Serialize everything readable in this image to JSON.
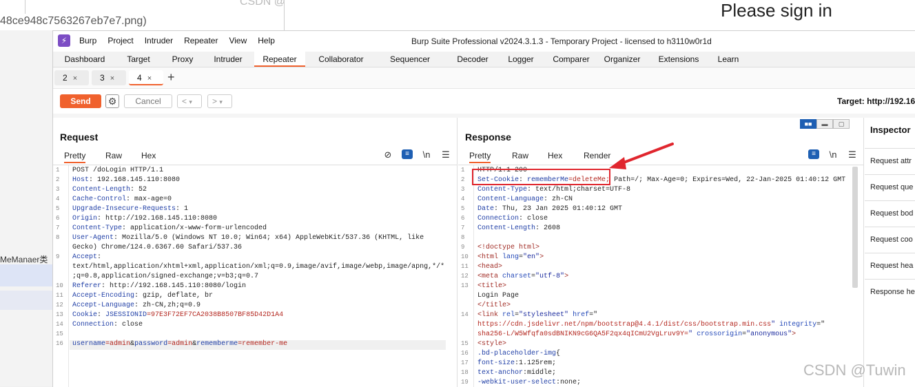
{
  "background": {
    "filename": "48ce948c7563267eb7e7.png)",
    "csdn_top": "CSDN @",
    "signin": "Please sign in",
    "manager_text": "MeManaer类"
  },
  "app": {
    "title": "Burp Suite Professional v2024.3.1.3 - Temporary Project - licensed to h3110w0r1d",
    "menu": [
      "Burp",
      "Project",
      "Intruder",
      "Repeater",
      "View",
      "Help"
    ]
  },
  "main_tabs": [
    "Dashboard",
    "Target",
    "Proxy",
    "Intruder",
    "Repeater",
    "Collaborator",
    "Sequencer",
    "Decoder",
    "Logger",
    "Comparer",
    "Organizer",
    "Extensions",
    "Learn"
  ],
  "main_tab_active": "Repeater",
  "repeater_tabs": [
    {
      "label": "2",
      "close": "×"
    },
    {
      "label": "3",
      "close": "×"
    },
    {
      "label": "4",
      "close": "×"
    }
  ],
  "repeater_tab_plus": "+",
  "toolbar": {
    "send": "Send",
    "cancel": "Cancel",
    "back": "<",
    "forward": ">",
    "dropdown": "▾",
    "target": "Target: http://192.16"
  },
  "request": {
    "title": "Request",
    "tabs": [
      "Pretty",
      "Raw",
      "Hex"
    ],
    "newline_icon": "\\n",
    "lines": [
      {
        "n": "1",
        "parts": [
          [
            "v",
            "POST /doLogin HTTP/1.1"
          ]
        ]
      },
      {
        "n": "2",
        "parts": [
          [
            "k",
            "Host"
          ],
          [
            "v",
            ": 192.168.145.110:8080"
          ]
        ]
      },
      {
        "n": "3",
        "parts": [
          [
            "k",
            "Content-Length"
          ],
          [
            "v",
            ": 52"
          ]
        ]
      },
      {
        "n": "4",
        "parts": [
          [
            "k",
            "Cache-Control"
          ],
          [
            "v",
            ": max-age=0"
          ]
        ]
      },
      {
        "n": "5",
        "parts": [
          [
            "k",
            "Upgrade-Insecure-Requests"
          ],
          [
            "v",
            ": 1"
          ]
        ]
      },
      {
        "n": "6",
        "parts": [
          [
            "k",
            "Origin"
          ],
          [
            "v",
            ": http://192.168.145.110:8080"
          ]
        ]
      },
      {
        "n": "7",
        "parts": [
          [
            "k",
            "Content-Type"
          ],
          [
            "v",
            ": application/x-www-form-urlencoded"
          ]
        ]
      },
      {
        "n": "8",
        "parts": [
          [
            "k",
            "User-Agent"
          ],
          [
            "v",
            ": Mozilla/5.0 (Windows NT 10.0; Win64; x64) AppleWebKit/537.36 (KHTML, like"
          ]
        ]
      },
      {
        "n": "",
        "parts": [
          [
            "v",
            "Gecko) Chrome/124.0.6367.60 Safari/537.36"
          ]
        ]
      },
      {
        "n": "9",
        "parts": [
          [
            "k",
            "Accept"
          ],
          [
            "v",
            ":"
          ]
        ]
      },
      {
        "n": "",
        "parts": [
          [
            "v",
            "text/html,application/xhtml+xml,application/xml;q=0.9,image/avif,image/webp,image/apng,*/*"
          ]
        ]
      },
      {
        "n": "",
        "parts": [
          [
            "v",
            ";q=0.8,application/signed-exchange;v=b3;q=0.7"
          ]
        ]
      },
      {
        "n": "10",
        "parts": [
          [
            "k",
            "Referer"
          ],
          [
            "v",
            ": http://192.168.145.110:8080/login"
          ]
        ]
      },
      {
        "n": "11",
        "parts": [
          [
            "k",
            "Accept-Encoding"
          ],
          [
            "v",
            ": gzip, deflate, br"
          ]
        ]
      },
      {
        "n": "12",
        "parts": [
          [
            "k",
            "Accept-Language"
          ],
          [
            "v",
            ": zh-CN,zh;q=0.9"
          ]
        ]
      },
      {
        "n": "13",
        "parts": [
          [
            "k",
            "Cookie"
          ],
          [
            "v",
            ": "
          ],
          [
            "k",
            "JSESSIONID"
          ],
          [
            "red",
            "=97E3F72EF7CA2038B8507BF85D42D1A4"
          ]
        ]
      },
      {
        "n": "14",
        "parts": [
          [
            "k",
            "Connection"
          ],
          [
            "v",
            ": close"
          ]
        ]
      },
      {
        "n": "15",
        "parts": []
      },
      {
        "n": "16",
        "parts": [
          [
            "k",
            "username"
          ],
          [
            "red",
            "="
          ],
          [
            "red",
            "admin"
          ],
          [
            "v",
            "&"
          ],
          [
            "k",
            "password"
          ],
          [
            "red",
            "="
          ],
          [
            "red",
            "admin"
          ],
          [
            "v",
            "&"
          ],
          [
            "k",
            "rememberme"
          ],
          [
            "red",
            "="
          ],
          [
            "red",
            "remember-me"
          ]
        ]
      }
    ]
  },
  "response": {
    "title": "Response",
    "tabs": [
      "Pretty",
      "Raw",
      "Hex",
      "Render"
    ],
    "newline_icon": "\\n",
    "lines": [
      {
        "n": "1",
        "parts": [
          [
            "v",
            "HTTP/1.1 200"
          ]
        ]
      },
      {
        "n": "2",
        "parts": [
          [
            "k",
            "Set-Cookie"
          ],
          [
            "v",
            ": "
          ],
          [
            "k",
            "rememberMe"
          ],
          [
            "red",
            "=deleteMe;"
          ],
          [
            "v",
            " Path=/; Max-Age=0; Expires=Wed, 22-Jan-2025 01:40:12 GMT"
          ]
        ]
      },
      {
        "n": "3",
        "parts": [
          [
            "k",
            "Content-Type"
          ],
          [
            "v",
            ": text/html;charset=UTF-8"
          ]
        ]
      },
      {
        "n": "4",
        "parts": [
          [
            "k",
            "Content-Language"
          ],
          [
            "v",
            ": zh-CN"
          ]
        ]
      },
      {
        "n": "5",
        "parts": [
          [
            "k",
            "Date"
          ],
          [
            "v",
            ": Thu, 23 Jan 2025 01:40:12 GMT"
          ]
        ]
      },
      {
        "n": "6",
        "parts": [
          [
            "k",
            "Connection"
          ],
          [
            "v",
            ": close"
          ]
        ]
      },
      {
        "n": "7",
        "parts": [
          [
            "k",
            "Content-Length"
          ],
          [
            "v",
            ": 2608"
          ]
        ]
      },
      {
        "n": "8",
        "parts": []
      },
      {
        "n": "9",
        "parts": [
          [
            "tag",
            "<!doctype html>"
          ]
        ]
      },
      {
        "n": "10",
        "parts": [
          [
            "tag",
            "<html "
          ],
          [
            "attr",
            "lang"
          ],
          [
            "v",
            "="
          ],
          [
            "str",
            "\"en\""
          ],
          [
            "tag",
            ">"
          ]
        ]
      },
      {
        "n": "11",
        "parts": [
          [
            "v",
            "  "
          ],
          [
            "tag",
            "<head>"
          ]
        ]
      },
      {
        "n": "12",
        "parts": [
          [
            "v",
            "    "
          ],
          [
            "tag",
            "<meta "
          ],
          [
            "attr",
            "charset"
          ],
          [
            "v",
            "="
          ],
          [
            "str",
            "\"utf-8\""
          ],
          [
            "tag",
            ">"
          ]
        ]
      },
      {
        "n": "13",
        "parts": [
          [
            "v",
            "    "
          ],
          [
            "tag",
            "<title>"
          ]
        ]
      },
      {
        "n": "",
        "parts": [
          [
            "v",
            "      Login Page"
          ]
        ]
      },
      {
        "n": "",
        "parts": [
          [
            "v",
            "    "
          ],
          [
            "tag",
            "</title>"
          ]
        ]
      },
      {
        "n": "14",
        "parts": [
          [
            "v",
            "    "
          ],
          [
            "tag",
            "<link "
          ],
          [
            "attr",
            "rel"
          ],
          [
            "v",
            "="
          ],
          [
            "str",
            "\"stylesheet\""
          ],
          [
            "attr",
            " href"
          ],
          [
            "v",
            "=\""
          ]
        ]
      },
      {
        "n": "",
        "parts": [
          [
            "red",
            "    https://cdn.jsdelivr.net/npm/bootstrap@4.4.1/dist/css/bootstrap.min.css"
          ],
          [
            "str",
            "\""
          ],
          [
            "attr",
            " integrity"
          ],
          [
            "v",
            "=\""
          ]
        ]
      },
      {
        "n": "",
        "parts": [
          [
            "red",
            "    sha256-L/W5Wfqfa0sdBNIKN9cG6QA5F2qx4qICmU2VgLruv9Y="
          ],
          [
            "str",
            "\""
          ],
          [
            "attr",
            " crossorigin"
          ],
          [
            "v",
            "="
          ],
          [
            "str",
            "\"anonymous\""
          ],
          [
            "tag",
            ">"
          ]
        ]
      },
      {
        "n": "15",
        "parts": [
          [
            "v",
            "    "
          ],
          [
            "tag",
            "<style>"
          ]
        ]
      },
      {
        "n": "16",
        "parts": [
          [
            "v",
            "      "
          ],
          [
            "k",
            ".bd-placeholder-img"
          ],
          [
            "v",
            "{"
          ]
        ]
      },
      {
        "n": "17",
        "parts": [
          [
            "v",
            "        "
          ],
          [
            "k",
            "font-size"
          ],
          [
            "v",
            ":1.125rem;"
          ]
        ]
      },
      {
        "n": "18",
        "parts": [
          [
            "v",
            "        "
          ],
          [
            "k",
            "text-anchor"
          ],
          [
            "v",
            ":middle;"
          ]
        ]
      },
      {
        "n": "19",
        "parts": [
          [
            "v",
            "        "
          ],
          [
            "k",
            "-webkit-user-select"
          ],
          [
            "v",
            ":none;"
          ]
        ]
      }
    ]
  },
  "inspector": {
    "title": "Inspector",
    "items": [
      "Request attr",
      "Request que",
      "Request bod",
      "Request coo",
      "Request hea",
      "Response he"
    ]
  },
  "watermark": "CSDN @Tuwin",
  "colors": {
    "accent": "#f0612d",
    "annotation": "#e0262e",
    "header_key": "#1f3ea6",
    "value_red": "#b3261e",
    "toggle_blue": "#1e5fb3"
  }
}
